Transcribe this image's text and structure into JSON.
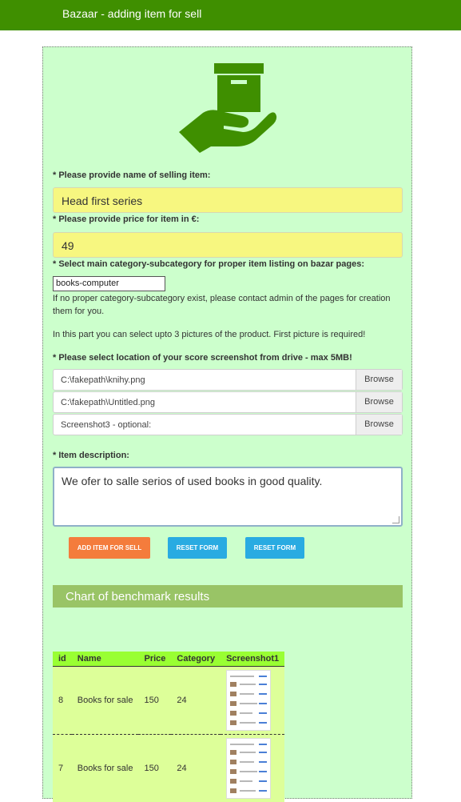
{
  "header": {
    "title": "Bazaar - adding item for sell"
  },
  "form": {
    "name_label": "* Please provide name of selling item:",
    "name_value": "Head first series",
    "price_label": "* Please provide price for item in €:",
    "price_value": "49",
    "category_label": "* Select main category-subcategory for proper item listing on bazar pages:",
    "category_value": "books-computer",
    "category_note": "If no proper category-subcategory exist, please contact admin of the pages for creation them for you.",
    "pictures_note": "In this part you can select upto 3 pictures of the product. First picture is required!",
    "location_label": "* Please select location of your score screenshot from drive - max 5MB!",
    "files": [
      {
        "path": "C:\\fakepath\\knihy.png",
        "browse": "Browse"
      },
      {
        "path": "C:\\fakepath\\Untitled.png",
        "browse": "Browse"
      },
      {
        "path": "Screenshot3 - optional:",
        "browse": "Browse"
      }
    ],
    "description_label": "* Item description:",
    "description_value": "We ofer to salle serios of used books in good quality.",
    "buttons": {
      "add": "ADD ITEM FOR SELL",
      "reset1": "RESET FORM",
      "reset2": "RESET FORM"
    }
  },
  "colors": {
    "header": "#3f8f00",
    "panel": "#ccffcc",
    "add_button": "#f47c3c",
    "reset_button": "#29abe2",
    "section_bar": "#99c466"
  },
  "section": {
    "title": "Chart of benchmark results"
  },
  "table": {
    "headers": [
      "id",
      "Name",
      "Price",
      "Category",
      "Screenshot1"
    ],
    "rows": [
      {
        "id": "8",
        "name": "Books for sale",
        "price": "150",
        "category": "24"
      },
      {
        "id": "7",
        "name": "Books for sale",
        "price": "150",
        "category": "24"
      }
    ]
  }
}
